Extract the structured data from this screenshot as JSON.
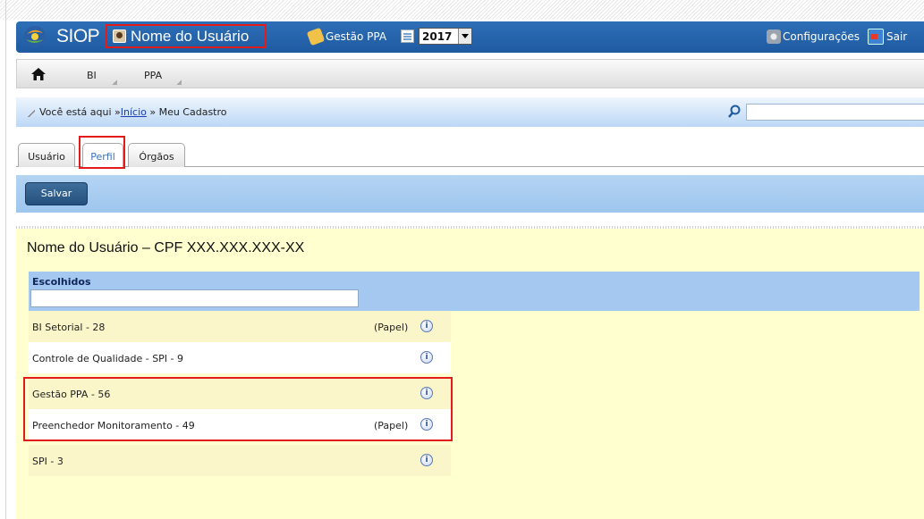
{
  "header": {
    "app_name": "SIOP",
    "user_name": "Nome do Usuário",
    "ppa_label": "Gestão PPA",
    "year": "2017",
    "settings_label": "Configurações",
    "exit_label": "Sair",
    "colors": {
      "bar": "#2d6fb7",
      "highlight": "#e31b1b"
    },
    "icons": [
      "siop-logo-icon",
      "user-icon",
      "key-icon",
      "calendar-icon",
      "settings-icon",
      "exit-icon"
    ]
  },
  "menu": {
    "items": [
      {
        "label": "BI"
      },
      {
        "label": "PPA"
      }
    ]
  },
  "breadcrumb": {
    "prefix": "Você está aqui »",
    "link": "Início",
    "current": " » Meu Cadastro"
  },
  "search": {
    "placeholder": ""
  },
  "tabs": [
    {
      "label": "Usuário"
    },
    {
      "label": "Perfil",
      "active": true
    },
    {
      "label": "Órgãos"
    }
  ],
  "actions": {
    "save_label": "Salvar"
  },
  "panel": {
    "title": "Nome do Usuário – CPF XXX.XXX.XXX-XX",
    "chosen_label": "Escolhidos",
    "items": [
      {
        "label": "BI Setorial - 28",
        "role": "(Papel)"
      },
      {
        "label": "Controle de Qualidade - SPI - 9",
        "role": ""
      },
      {
        "label": "Gestão PPA - 56",
        "role": ""
      },
      {
        "label": "Preenchedor Monitoramento - 49",
        "role": "(Papel)"
      },
      {
        "label": "SPI - 3",
        "role": ""
      }
    ],
    "info_symbol": "i"
  }
}
